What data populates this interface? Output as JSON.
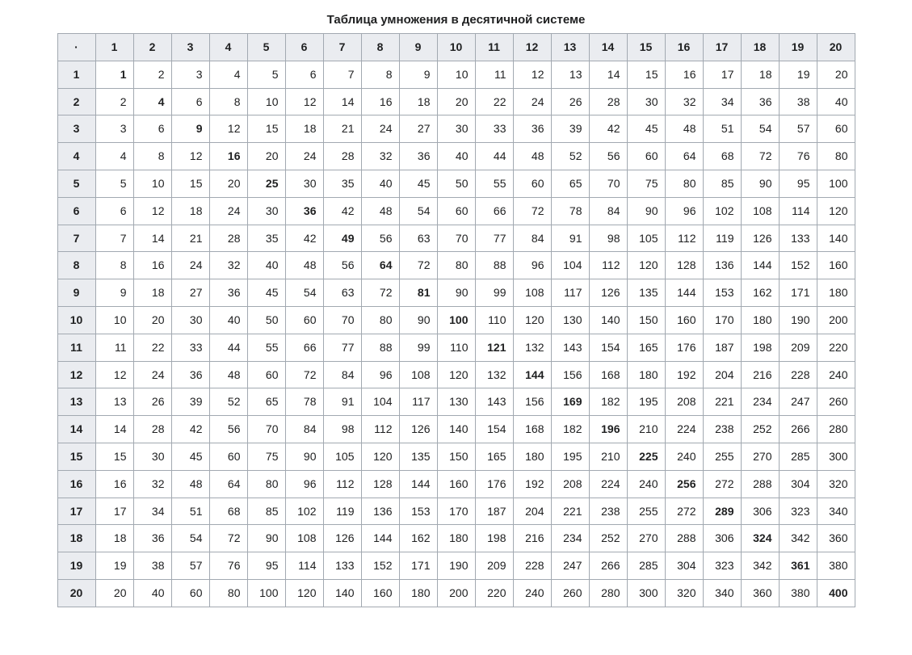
{
  "title": "Таблица умножения в десятичной системе",
  "corner_symbol": "·",
  "chart_data": {
    "type": "table",
    "title": "Таблица умножения в десятичной системе",
    "row_headers": [
      1,
      2,
      3,
      4,
      5,
      6,
      7,
      8,
      9,
      10,
      11,
      12,
      13,
      14,
      15,
      16,
      17,
      18,
      19,
      20
    ],
    "col_headers": [
      1,
      2,
      3,
      4,
      5,
      6,
      7,
      8,
      9,
      10,
      11,
      12,
      13,
      14,
      15,
      16,
      17,
      18,
      19,
      20
    ],
    "values": [
      [
        1,
        2,
        3,
        4,
        5,
        6,
        7,
        8,
        9,
        10,
        11,
        12,
        13,
        14,
        15,
        16,
        17,
        18,
        19,
        20
      ],
      [
        2,
        4,
        6,
        8,
        10,
        12,
        14,
        16,
        18,
        20,
        22,
        24,
        26,
        28,
        30,
        32,
        34,
        36,
        38,
        40
      ],
      [
        3,
        6,
        9,
        12,
        15,
        18,
        21,
        24,
        27,
        30,
        33,
        36,
        39,
        42,
        45,
        48,
        51,
        54,
        57,
        60
      ],
      [
        4,
        8,
        12,
        16,
        20,
        24,
        28,
        32,
        36,
        40,
        44,
        48,
        52,
        56,
        60,
        64,
        68,
        72,
        76,
        80
      ],
      [
        5,
        10,
        15,
        20,
        25,
        30,
        35,
        40,
        45,
        50,
        55,
        60,
        65,
        70,
        75,
        80,
        85,
        90,
        95,
        100
      ],
      [
        6,
        12,
        18,
        24,
        30,
        36,
        42,
        48,
        54,
        60,
        66,
        72,
        78,
        84,
        90,
        96,
        102,
        108,
        114,
        120
      ],
      [
        7,
        14,
        21,
        28,
        35,
        42,
        49,
        56,
        63,
        70,
        77,
        84,
        91,
        98,
        105,
        112,
        119,
        126,
        133,
        140
      ],
      [
        8,
        16,
        24,
        32,
        40,
        48,
        56,
        64,
        72,
        80,
        88,
        96,
        104,
        112,
        120,
        128,
        136,
        144,
        152,
        160
      ],
      [
        9,
        18,
        27,
        36,
        45,
        54,
        63,
        72,
        81,
        90,
        99,
        108,
        117,
        126,
        135,
        144,
        153,
        162,
        171,
        180
      ],
      [
        10,
        20,
        30,
        40,
        50,
        60,
        70,
        80,
        90,
        100,
        110,
        120,
        130,
        140,
        150,
        160,
        170,
        180,
        190,
        200
      ],
      [
        11,
        22,
        33,
        44,
        55,
        66,
        77,
        88,
        99,
        110,
        121,
        132,
        143,
        154,
        165,
        176,
        187,
        198,
        209,
        220
      ],
      [
        12,
        24,
        36,
        48,
        60,
        72,
        84,
        96,
        108,
        120,
        132,
        144,
        156,
        168,
        180,
        192,
        204,
        216,
        228,
        240
      ],
      [
        13,
        26,
        39,
        52,
        65,
        78,
        91,
        104,
        117,
        130,
        143,
        156,
        169,
        182,
        195,
        208,
        221,
        234,
        247,
        260
      ],
      [
        14,
        28,
        42,
        56,
        70,
        84,
        98,
        112,
        126,
        140,
        154,
        168,
        182,
        196,
        210,
        224,
        238,
        252,
        266,
        280
      ],
      [
        15,
        30,
        45,
        60,
        75,
        90,
        105,
        120,
        135,
        150,
        165,
        180,
        195,
        210,
        225,
        240,
        255,
        270,
        285,
        300
      ],
      [
        16,
        32,
        48,
        64,
        80,
        96,
        112,
        128,
        144,
        160,
        176,
        192,
        208,
        224,
        240,
        256,
        272,
        288,
        304,
        320
      ],
      [
        17,
        34,
        51,
        68,
        85,
        102,
        119,
        136,
        153,
        170,
        187,
        204,
        221,
        238,
        255,
        272,
        289,
        306,
        323,
        340
      ],
      [
        18,
        36,
        54,
        72,
        90,
        108,
        126,
        144,
        162,
        180,
        198,
        216,
        234,
        252,
        270,
        288,
        306,
        324,
        342,
        360
      ],
      [
        19,
        38,
        57,
        76,
        95,
        114,
        133,
        152,
        171,
        190,
        209,
        228,
        247,
        266,
        285,
        304,
        323,
        342,
        361,
        380
      ],
      [
        20,
        40,
        60,
        80,
        100,
        120,
        140,
        160,
        180,
        200,
        220,
        240,
        260,
        280,
        300,
        320,
        340,
        360,
        380,
        400
      ]
    ]
  }
}
